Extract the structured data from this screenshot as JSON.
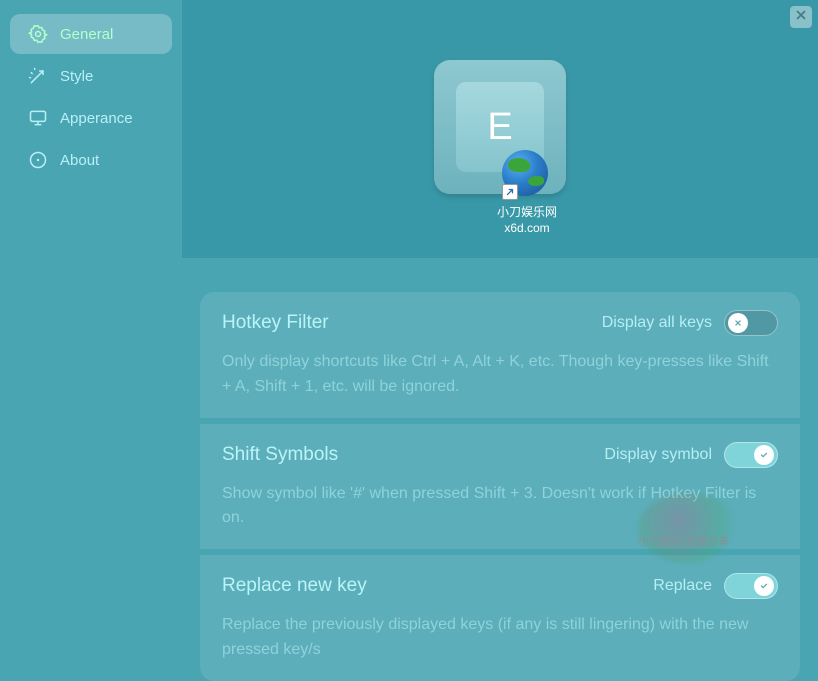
{
  "close_label": "Close",
  "sidebar": {
    "items": [
      {
        "label": "General",
        "icon": "gear-icon",
        "active": true
      },
      {
        "label": "Style",
        "icon": "wand-icon",
        "active": false
      },
      {
        "label": "Apperance",
        "icon": "monitor-icon",
        "active": false
      },
      {
        "label": "About",
        "icon": "info-icon",
        "active": false
      }
    ]
  },
  "preview": {
    "key_letter": "E",
    "desktop_shortcut": {
      "line1": "小刀娱乐网",
      "line2": "x6d.com"
    }
  },
  "settings": [
    {
      "title": "Hotkey Filter",
      "right_label": "Display all keys",
      "toggle_on": false,
      "description": "Only display shortcuts like Ctrl + A, Alt + K, etc. Though key-presses like Shift + A, Shift + 1, etc. will be ignored."
    },
    {
      "title": "Shift Symbols",
      "right_label": "Display symbol",
      "toggle_on": true,
      "description": "Show symbol like '#' when pressed Shift + 3. Doesn't work if Hotkey Filter is on."
    },
    {
      "title": "Replace new key",
      "right_label": "Replace",
      "toggle_on": true,
      "description": "Replace the previously displayed keys (if any is still lingering) with the new pressed key/s"
    }
  ],
  "watermark_text": "小刀娱乐 资源分享"
}
